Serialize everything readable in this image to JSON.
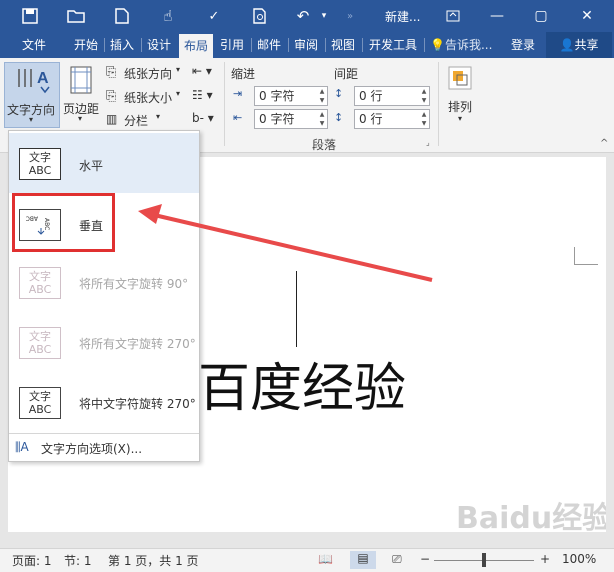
{
  "titlebar": {
    "doc_title": "新建...",
    "icons": [
      "save-icon",
      "open-icon",
      "new-icon",
      "touch-mode-icon",
      "spelling-icon",
      "print-preview-icon",
      "undo-icon",
      "chevron-right-icon",
      "ribbon-display-icon",
      "minimize-icon",
      "maximize-icon",
      "close-icon"
    ]
  },
  "tabs": [
    "文件",
    "开始",
    "插入",
    "设计",
    "布局",
    "引用",
    "邮件",
    "审阅",
    "视图",
    "开发工具"
  ],
  "tell_me": "告诉我...",
  "login": "登录",
  "share": "共享",
  "ribbon": {
    "text_direction": "文字方向",
    "margins": "页边距",
    "orientation": "纸张方向",
    "size": "纸张大小",
    "columns": "分栏",
    "indent_label": "缩进",
    "spacing_label": "间距",
    "indent_left": "0 字符",
    "indent_right": "0 字符",
    "spacing_before": "0 行",
    "spacing_after": "0 行",
    "paragraph_group": "段落",
    "arrange": "排列"
  },
  "menu": {
    "items": [
      {
        "icon_text": "文字\nABC",
        "label": "水平"
      },
      {
        "icon_text": "",
        "label": "垂直"
      },
      {
        "icon_text": "文字\nABC",
        "label": "将所有文字旋转 90°"
      },
      {
        "icon_text": "文字\nABC",
        "label": "将所有文字旋转 270°"
      },
      {
        "icon_text": "文字\nABC",
        "label": "将中文字符旋转 270°"
      }
    ],
    "options": "文字方向选项(X)..."
  },
  "document": {
    "body_text": "百度经验"
  },
  "status": {
    "page": "页面: 1",
    "section": "节: 1",
    "page_of": "第 1 页，共 1 页",
    "zoom": "100%"
  },
  "watermark": "Baidu经验",
  "colors": {
    "accent": "#2b579a",
    "highlight_box": "#e03030",
    "arrow": "#e84a4a"
  }
}
